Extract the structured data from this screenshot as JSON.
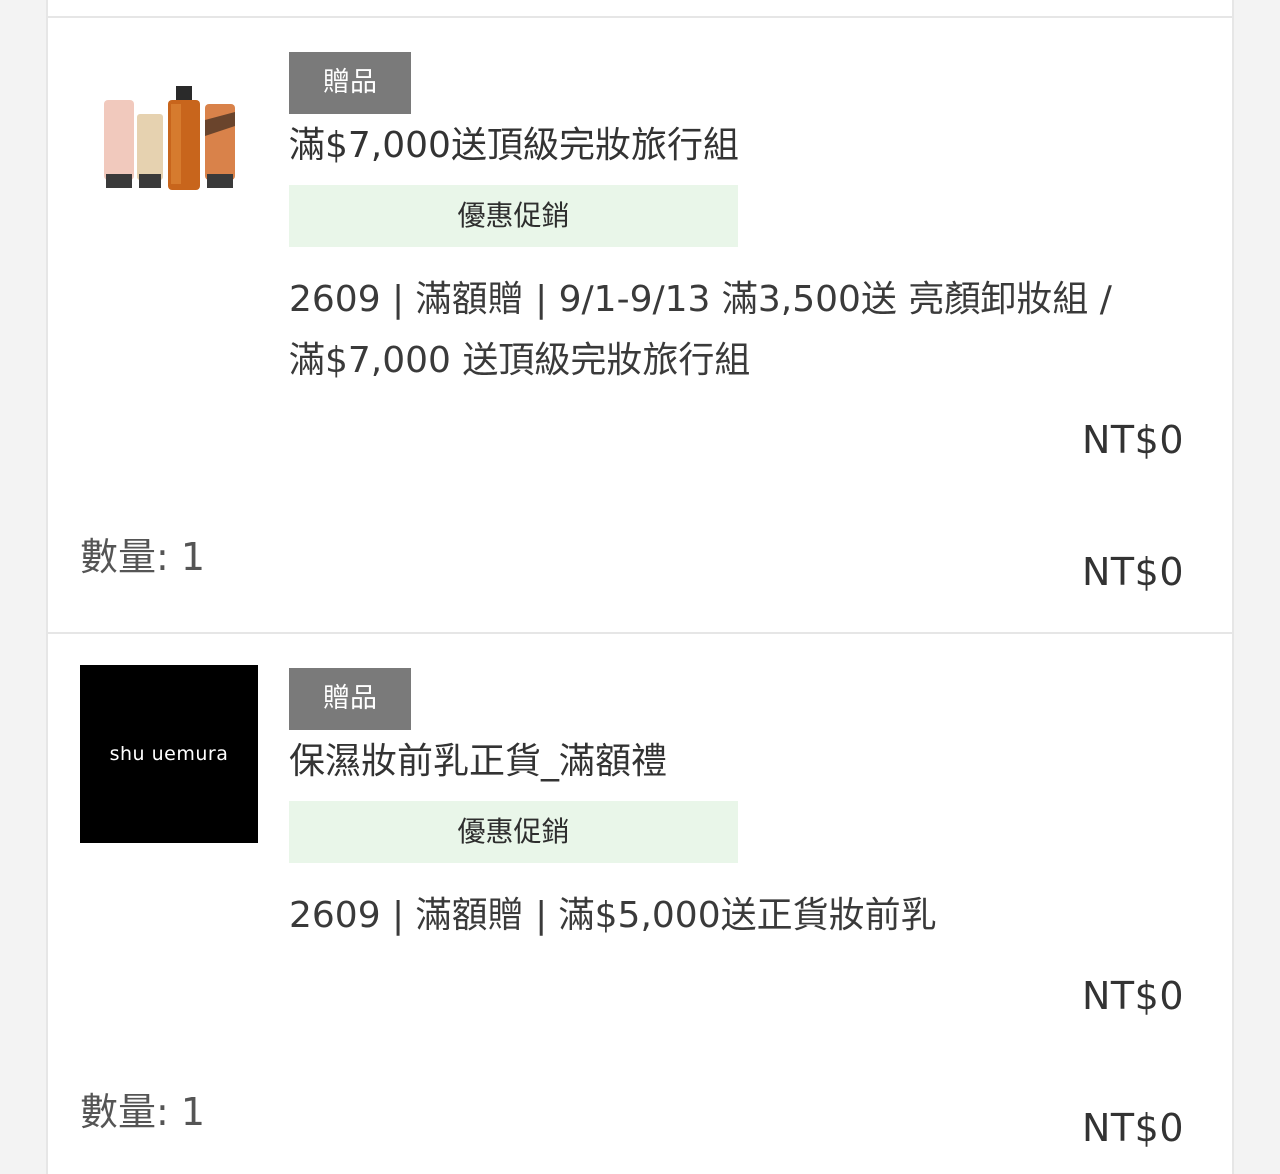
{
  "items": [
    {
      "tag": "贈品",
      "name": "滿$7,000送頂級完妝旅行組",
      "promo_badge": "優惠促銷",
      "promo_desc_line1": "2609 | 滿額贈 | 9/1-9/13 滿3,500送 亮顏卸妝組 /",
      "promo_desc_line2": "滿$7,000 送頂級完妝旅行組",
      "unit_price": "NT$0",
      "quantity_label": "數量: 1",
      "total_price": "NT$0",
      "thumbnail": "product-set-image"
    },
    {
      "tag": "贈品",
      "name": "保濕妝前乳正貨_滿額禮",
      "promo_badge": "優惠促銷",
      "promo_desc_line1": "2609 | 滿額贈 | 滿$5,000送正貨妝前乳",
      "unit_price": "NT$0",
      "quantity_label": "數量: 1",
      "total_price": "NT$0",
      "thumbnail_text": "shu uemura"
    }
  ],
  "colors": {
    "tag_bg": "#7a7a7a",
    "promo_bg": "#e9f6e9",
    "divider": "#e6e6e6"
  }
}
